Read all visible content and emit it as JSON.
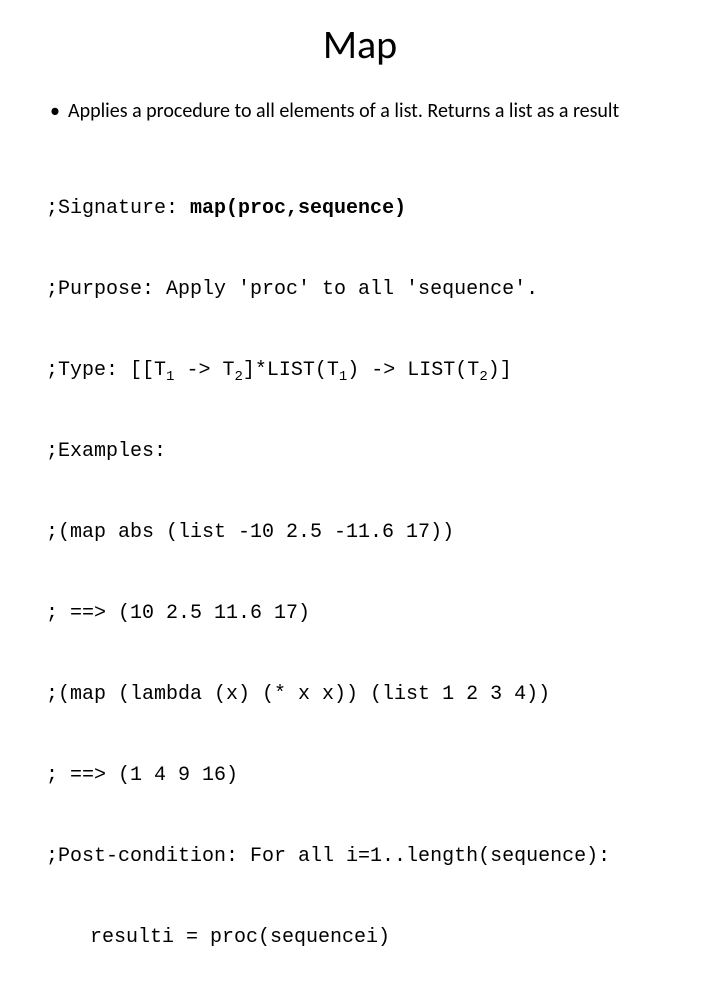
{
  "title": "Map",
  "bullet": "Applies a procedure to all elements of a list. Returns a list as a result",
  "code": {
    "sig_prefix": ";Signature: ",
    "sig_bold": "map(proc,sequence)",
    "purpose": ";Purpose: Apply 'proc' to all 'sequence'.",
    "type_prefix": ";Type: [[T",
    "type_mid1": " -> T",
    "type_mid2": "]*LIST(T",
    "type_mid3": ") -> LIST(T",
    "type_end": ")]",
    "sub1": "1",
    "sub2": "2",
    "examples": ";Examples:",
    "ex1": ";(map abs (list -10 2.5 -11.6 17))",
    "ex1r": "; ==> (10 2.5 11.6 17)",
    "ex2": ";(map (lambda (x) (* x x)) (list 1 2 3 4))",
    "ex2r": "; ==> (1 4 9 16)",
    "post": ";Post-condition: For all i=1..length(sequence):",
    "post2": "resulti = proc(sequencei)"
  }
}
